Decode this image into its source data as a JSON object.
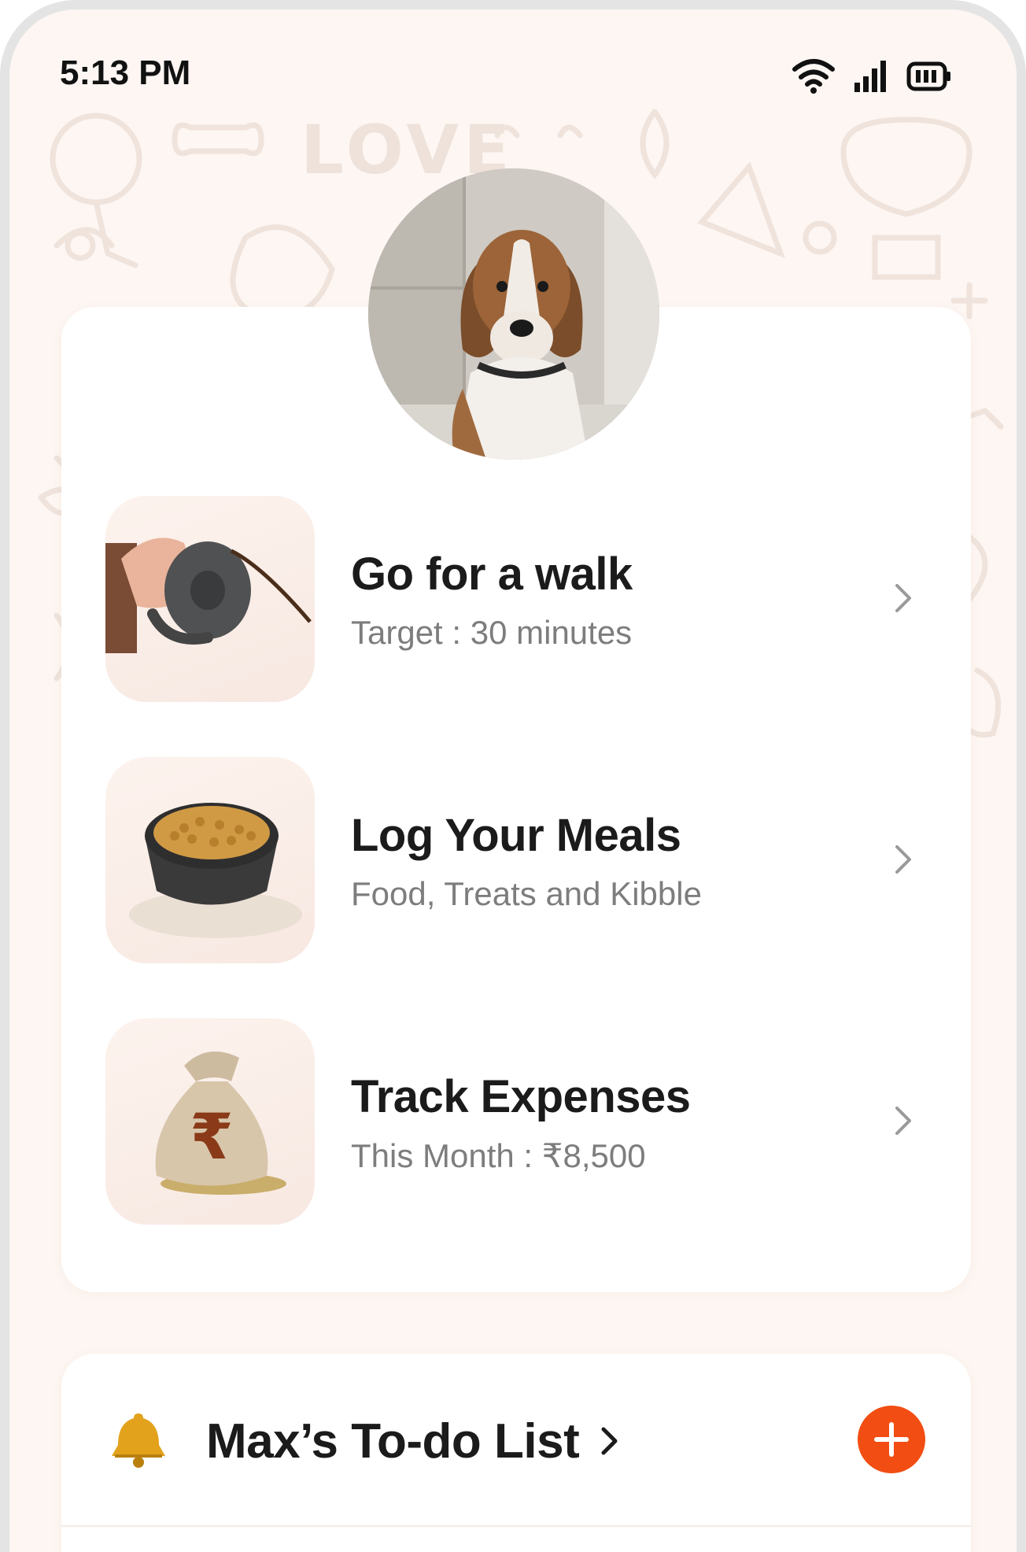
{
  "status_bar": {
    "time": "5:13 PM",
    "icons": [
      "wifi-icon",
      "signal-icon",
      "battery-icon"
    ]
  },
  "pet": {
    "avatar": "dog-avatar"
  },
  "activities": [
    {
      "title": "Go for a walk",
      "subtitle": "Target : 30 minutes",
      "icon": "leash-image"
    },
    {
      "title": "Log Your Meals",
      "subtitle": "Food, Treats and Kibble",
      "icon": "food-bowl-image"
    },
    {
      "title": "Track Expenses",
      "subtitle": "This Month : ₹8,500",
      "icon": "money-bag-image"
    }
  ],
  "todo": {
    "title": "Max’s To-do List",
    "icon": "bell-icon",
    "add_icon": "plus-icon"
  },
  "colors": {
    "background": "#fdf6f2",
    "card": "#ffffff",
    "accent": "#f24d12",
    "title_text": "#1b1b1b",
    "subtitle_text": "#7d7d7d"
  }
}
